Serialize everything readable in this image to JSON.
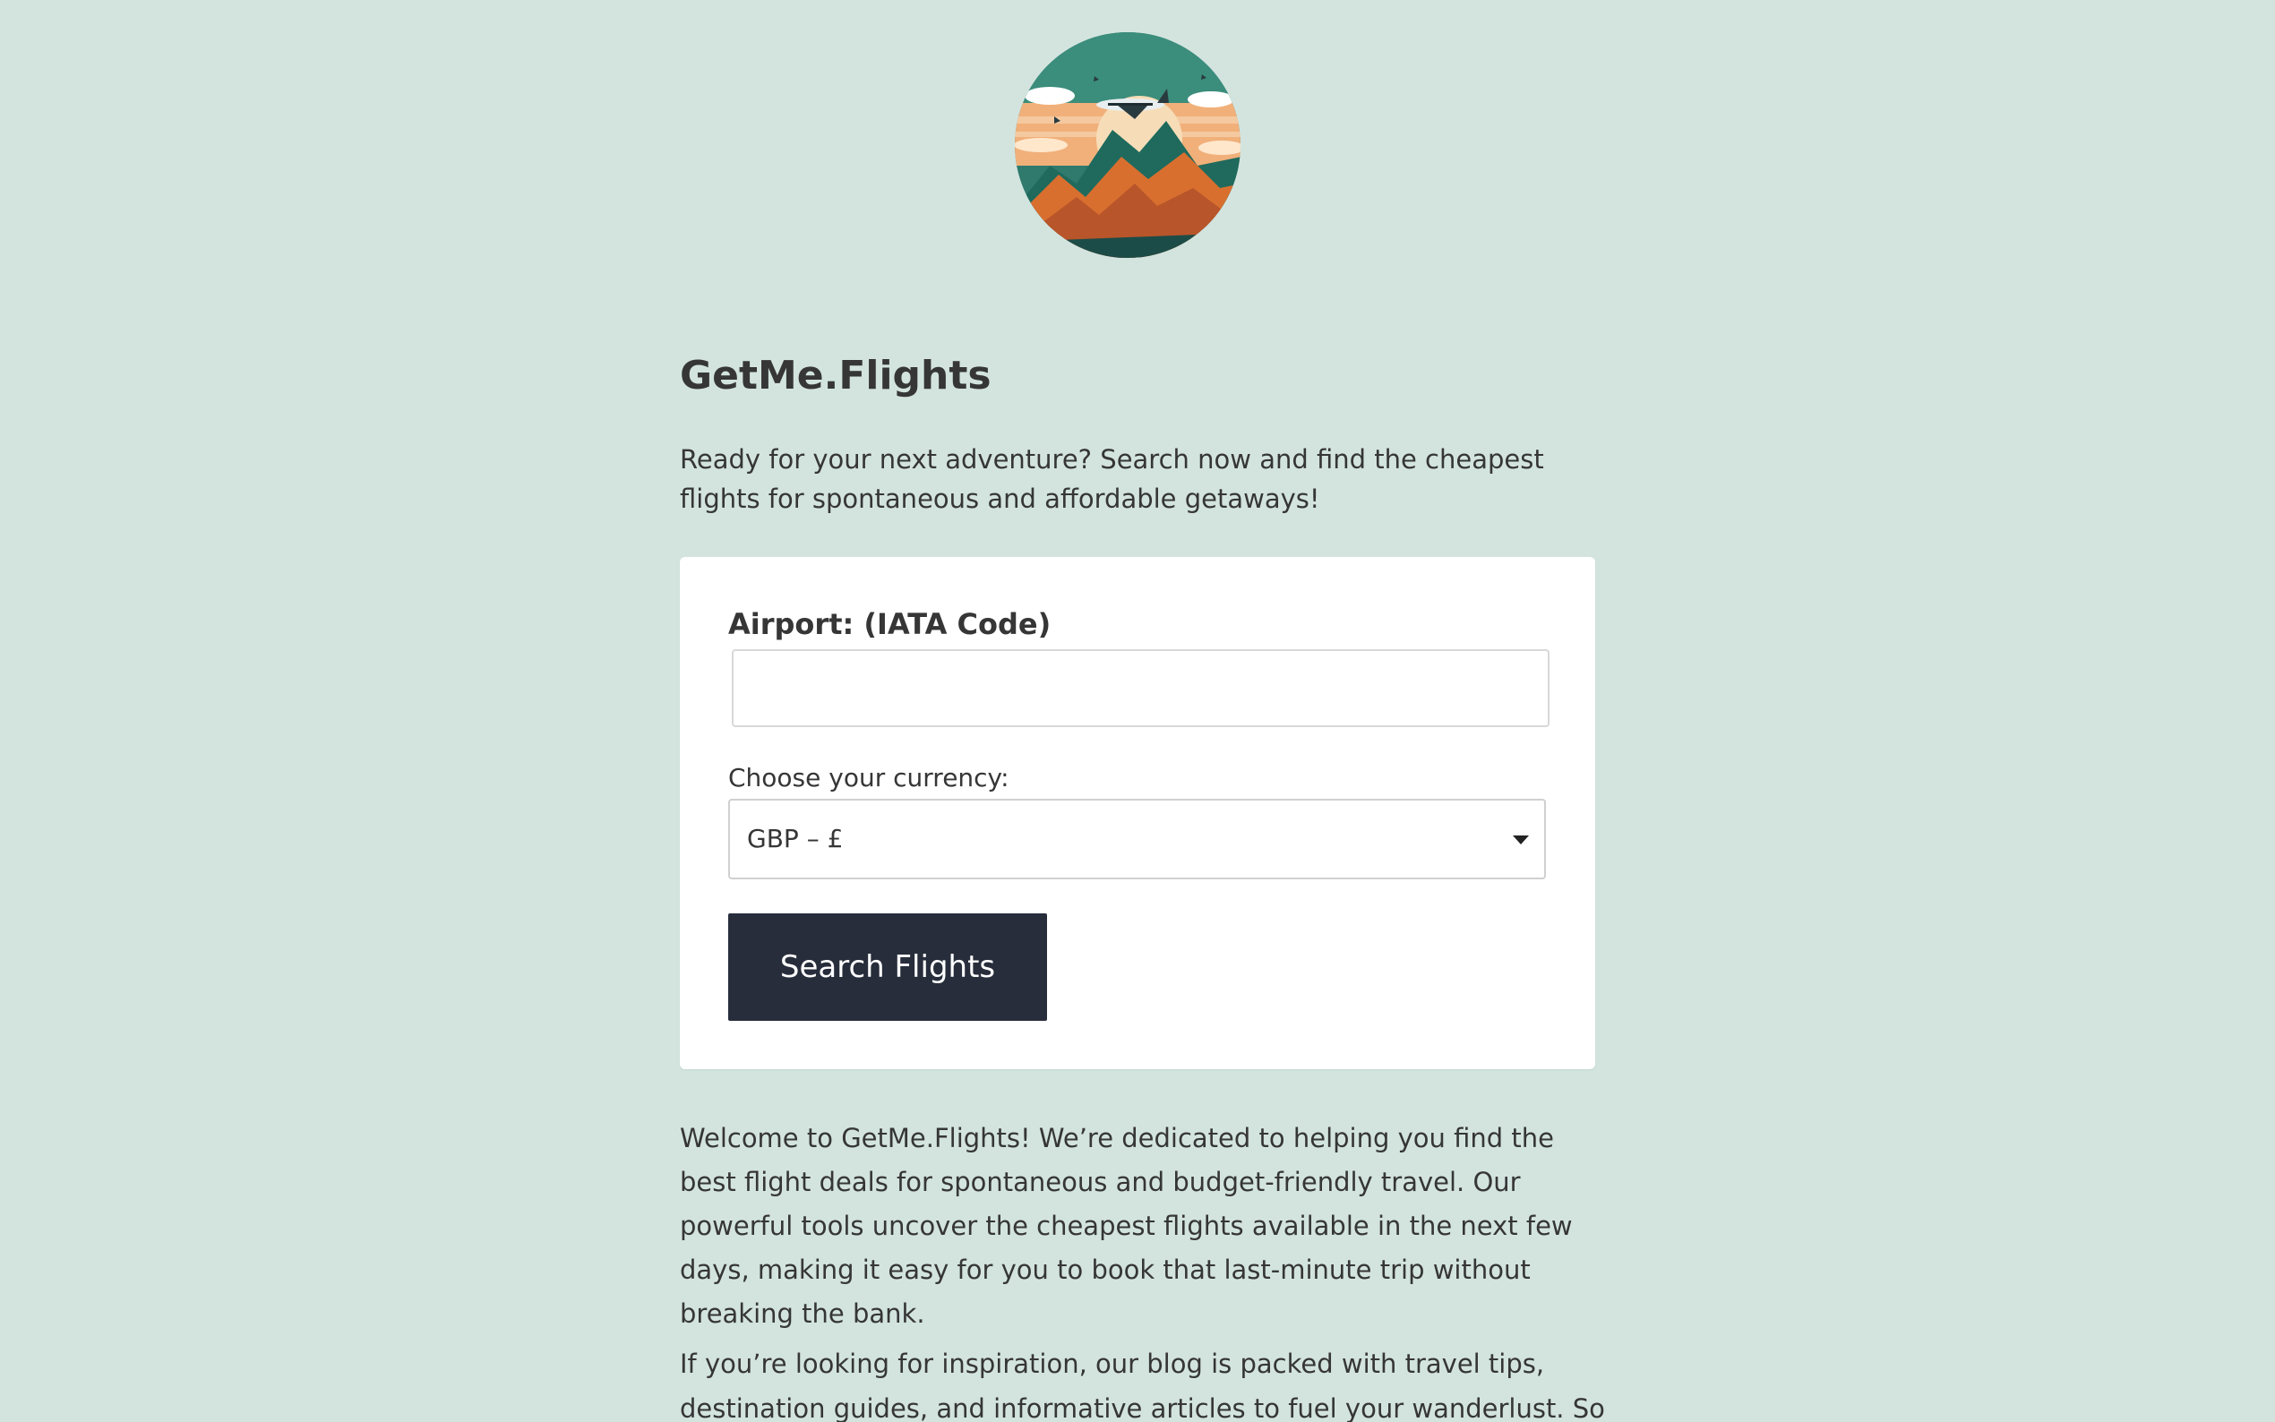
{
  "header": {
    "logo_alt": "GetMe.Flights logo - airplane over mountains at sunset"
  },
  "main": {
    "title": "GetMe.Flights",
    "tagline": "Ready for your next adventure? Search now and find the cheapest flights for spontaneous and affordable getaways!"
  },
  "search_form": {
    "airport_label": "Airport: (IATA Code)",
    "airport_value": "",
    "airport_placeholder": "",
    "currency_label": "Choose your currency:",
    "currency_selected": "GBP – £",
    "button_label": "Search Flights"
  },
  "about": {
    "intro": "Welcome to GetMe.Flights! We’re dedicated to helping you find the best flight deals for spontaneous and budget-friendly travel. Our powerful tools uncover the cheapest flights available in the next few days, making it easy for you to book that last-minute trip without breaking the bank.",
    "blog_text": "If you’re looking for inspiration, our blog is packed with travel tips, destination guides, and informative articles to fuel your wanderlust. So why"
  },
  "colors": {
    "background": "#d3e4df",
    "card": "#ffffff",
    "button": "#272d3b",
    "text": "#363636"
  }
}
